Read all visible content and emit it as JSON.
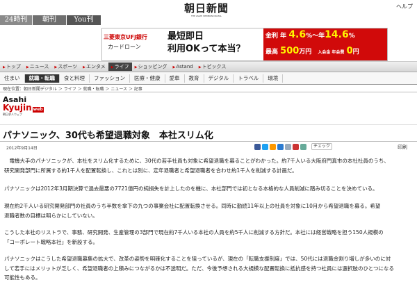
{
  "edition_tabs": [
    {
      "label": "24時刊",
      "color": "#8a8a8a"
    },
    {
      "label": "朝刊",
      "color": "#6f6f6f"
    },
    {
      "label": "You刊",
      "color": "#555555"
    }
  ],
  "masthead": {
    "title": "朝日新聞",
    "subtitle": "THE ASAHI SHIMBUN DIGITAL"
  },
  "helper_link": "ヘルプ",
  "ad": {
    "bank_name": "三菱東京UFJ銀行",
    "product": "カードローン",
    "headline1": "最短即日",
    "headline2": "利用OKって本当？",
    "rate_label": "金利",
    "rate_prefix": "年",
    "rate_low": "4.6",
    "rate_mid": "%〜年",
    "rate_high": "14.6",
    "rate_suffix": "%",
    "limit_label": "最高",
    "limit_value": "500",
    "limit_unit": "万円",
    "fee_label": "入会金 年会費",
    "fee_value": "0",
    "fee_unit": "円",
    "red_color": "#d10a0a"
  },
  "nav_primary": [
    {
      "label": "トップ"
    },
    {
      "label": "ニュース"
    },
    {
      "label": "スポーツ"
    },
    {
      "label": "エンタメ"
    },
    {
      "label": "ライフ",
      "active": true
    },
    {
      "label": "ショッピング"
    },
    {
      "label": "Astand"
    },
    {
      "label": "トピックス"
    }
  ],
  "nav_secondary": [
    {
      "label": "住まい"
    },
    {
      "label": "就職・転職",
      "active": true
    },
    {
      "label": "食と料理"
    },
    {
      "label": "ファッション"
    },
    {
      "label": "医療・健康"
    },
    {
      "label": "愛車"
    },
    {
      "label": "教育"
    },
    {
      "label": "デジタル"
    },
    {
      "label": "トラベル"
    },
    {
      "label": "環境"
    }
  ],
  "breadcrumb": "現在位置：朝日新聞デジタル ＞ ライフ ＞ 就職・転職 ＞ ニュース ＞ 記事",
  "logo": {
    "line1": "Asahi",
    "line2": "Kyujin",
    "badge": "web",
    "sub": "朝日求人ウェブ"
  },
  "article": {
    "title": "パナソニック、30代も希望退職対象　本社スリム化",
    "date": "2012年9月14日",
    "paragraphs": [
      "　電機大手のパナソニックが、本社をスリム化するために、30代の若手社員も対象に希望退職を募ることがわかった。約7千人いる大阪府門真市の本社社員のうち、\n研究開発部門に所属する約1千人を配置転換し、これとは別に、定年退職者と希望退職者を合わせ約1千人を削減する計画だ。",
      "パナソニックは2012年3月期決算で過去最悪の7721億円の純損失を計上したのを機に、本社部門では初となる本格的な人員削減に踏み切ることを決めている。",
      "現在約2千人いる研究開発部門の社員のうち半数を傘下の九つの事業会社に配置転換させる。同時に勤続11年以上の社員を対象に10月から希望退職を募る。希望\n退職者数の目標は明らかにしていない。",
      "こうした本社のリストラで、事務、研究開発、生産管理の3部門で現在約7千人いる本社の人員を約5千人に削減する方針だ。本社には経営戦略を担う150人規模の\n「コーポレート戦略本社」を新設する。",
      "パナソニックはこうした希望退職募集の拡大で、改革の姿勢を明確化することを狙っているが、現在の「転職支援制度」では、50代には退職金割り増しが多いのに対\nして若手にはメリットが乏しく、希望退職者の上積みにつながるかは不透明だ。ただ、今後予想される大規模な配置転換に抵抗感を持つ社員には選択肢のひとつになる\n可能性もある。"
    ]
  },
  "share_labels": {
    "check": "チェック",
    "print": "印刷"
  },
  "share_colors": [
    "#3b5998",
    "#1da1f2",
    "#f90",
    "#2c7bd0",
    "#9ab",
    "#c33",
    "#6a9"
  ]
}
